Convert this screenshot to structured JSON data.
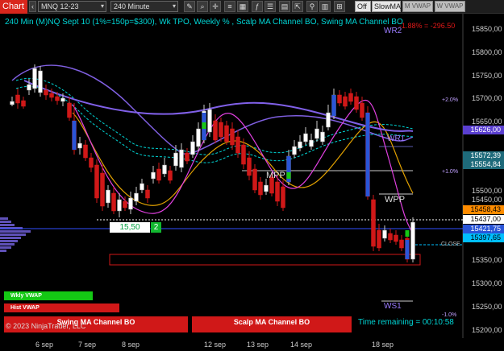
{
  "toolbar": {
    "tab_label": "Chart",
    "instrument": "MNQ 12-23",
    "interval": "240 Minute",
    "off_label": "Off",
    "indicator_select": "SlowMA",
    "btn_m_vwap": "M VWAP",
    "btn_w_vwap": "W VWAP"
  },
  "title": "240 Min (M)NQ Sept 10 (1%=150p=$300), Wk TPO, Weekly % , Scalp MA Channel BO, Swing MA Channel BO",
  "red_pct": "-1.88% = -296.50",
  "price_axis": [
    "15850,00",
    "15800,00",
    "15750,00",
    "15700,00",
    "15650,00",
    "15500,00",
    "15450,00",
    "15350,00",
    "15300,00",
    "15250,00",
    "15200,00"
  ],
  "price_boxes": [
    {
      "label": "15626,00",
      "bg": "#5a3fd0",
      "fg": "#ffffff"
    },
    {
      "label": "15572,39",
      "bg": "#1e6a7a",
      "fg": "#ffffff"
    },
    {
      "label": "15554,84",
      "bg": "#1e6a7a",
      "fg": "#ffffff"
    },
    {
      "label": "15458,43",
      "bg": "#ff8c00",
      "fg": "#000000"
    },
    {
      "label": "15437,00",
      "bg": "#ffffff",
      "fg": "#000000"
    },
    {
      "label": "15421,75",
      "bg": "#2a55d8",
      "fg": "#ffffff"
    },
    {
      "label": "15397,65",
      "bg": "#00bfff",
      "fg": "#000000"
    }
  ],
  "levels": {
    "wr2": "WR2",
    "wr1": "WR1",
    "mpp": "MPP",
    "wpp": "WPP",
    "ws1": "WS1",
    "close": "CLOSE"
  },
  "weekly_pct": {
    "p2": "+2.0%",
    "p1": "+1.0%",
    "m1": "-1.0%"
  },
  "dates": [
    "6 sep",
    "7 sep",
    "8 sep",
    "12 sep",
    "13 sep",
    "14 sep",
    "18 sep"
  ],
  "trade": {
    "price": "15,50",
    "qty": "2"
  },
  "buttons": {
    "wkly_vwap": "Wkly VWAP",
    "hist_vwap": "Hist VWAP",
    "swing_bo": "Swing MA Channel BO",
    "scalp_bo": "Scalp MA Channel BO"
  },
  "copyright": "© 2023 NinjaTrader, LLC",
  "time_remaining": "Time remaining = 00:10:58",
  "colors": {
    "background": "#000000",
    "title": "#00d5d5",
    "bullish": "#ffffff",
    "bearish": "#d01818",
    "accent_red": "#e01818",
    "purple_ma": "#7f5fe0",
    "cyan_ma": "#00d5d5",
    "orange_ma": "#e0a000",
    "magenta_ma": "#e040e0"
  }
}
